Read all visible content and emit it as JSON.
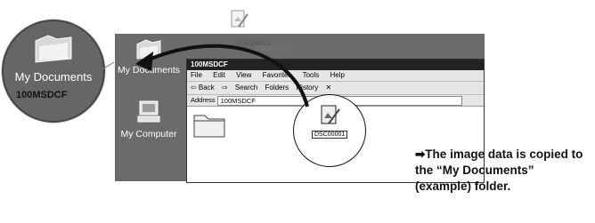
{
  "bubble": {
    "label": "My Documents"
  },
  "desktop": {
    "icons": [
      {
        "label": "My Documents"
      },
      {
        "label": "My Computer"
      }
    ]
  },
  "drag_ghost": {
    "file1": "DSC00001",
    "file2": "DSC00001"
  },
  "window": {
    "title": "100MSDCF",
    "menu": [
      "File",
      "Edit",
      "View",
      "Favorites",
      "Tools",
      "Help"
    ],
    "toolbar": [
      "⇦ Back",
      "⇨",
      "Search",
      "Folders",
      "History",
      "✕"
    ],
    "address_label": "Address",
    "address_value": "100MSDCF",
    "folder_label": "100MSDCF",
    "file_label": "DSC00001"
  },
  "description": "➡The image data is copied to the “My Documents” (example) folder."
}
